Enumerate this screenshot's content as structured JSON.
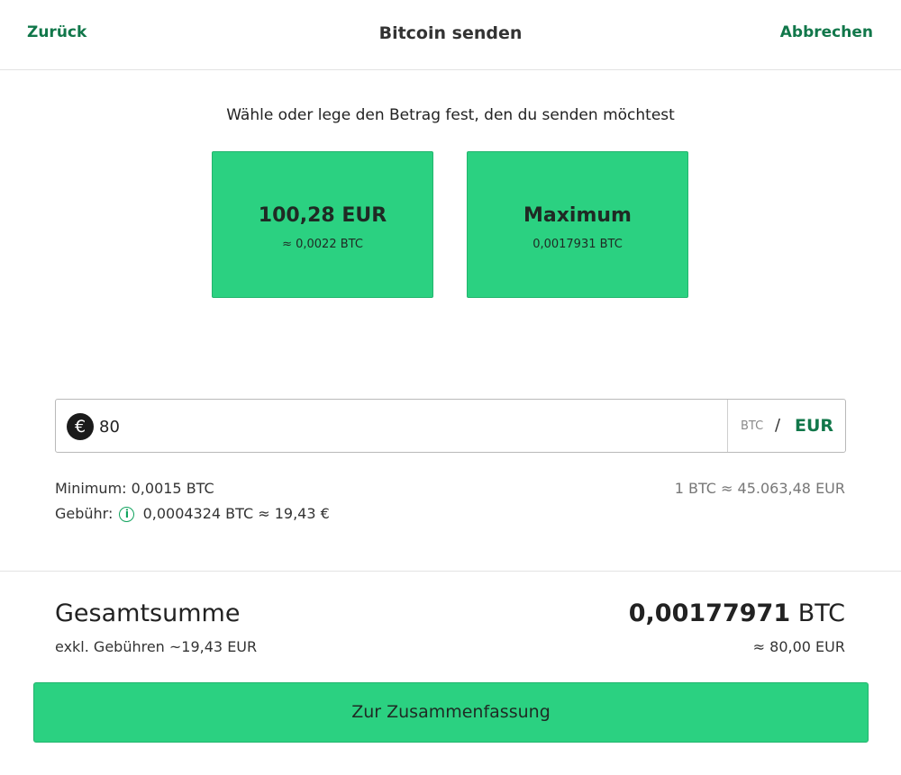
{
  "header": {
    "back_label": "Zurück",
    "title": "Bitcoin senden",
    "cancel_label": "Abbrechen"
  },
  "prompt": "Wähle oder lege den Betrag fest, den du senden möchtest",
  "presets": [
    {
      "main": "100,28 EUR",
      "sub": "≈ 0,0022 BTC"
    },
    {
      "main": "Maximum",
      "sub": "0,0017931 BTC"
    }
  ],
  "amount": {
    "currency_icon": "euro-icon",
    "currency_symbol": "€",
    "value": "80",
    "unit_btc": "BTC",
    "unit_separator": "/",
    "unit_eur": "EUR",
    "active_unit": "EUR"
  },
  "info": {
    "minimum": "Minimum: 0,0015 BTC",
    "fee_label": "Gebühr:",
    "fee_value": "0,0004324 BTC ≈ 19,43 €",
    "rate": "1 BTC ≈ 45.063,48 EUR"
  },
  "total": {
    "label": "Gesamtsumme",
    "sub": "exkl. Gebühren ~19,43 EUR",
    "value": "0,00177971",
    "unit": "BTC",
    "eur": "≈ 80,00 EUR"
  },
  "cta_label": "Zur Zusammenfassung",
  "colors": {
    "accent_green": "#2bd181",
    "link_green": "#11774a"
  }
}
